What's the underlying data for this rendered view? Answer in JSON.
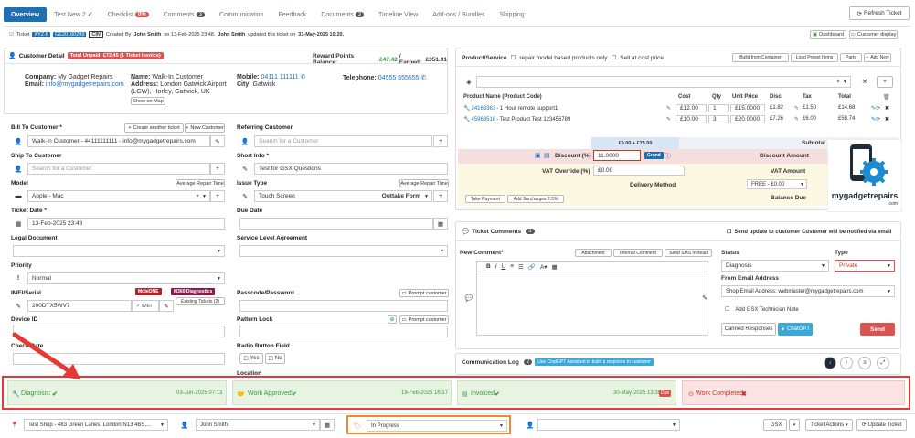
{
  "tabs": [
    {
      "label": "Overview"
    },
    {
      "label": "Test New 2",
      "mark": "✔"
    },
    {
      "label": "Checklist",
      "badge": "0%"
    },
    {
      "label": "Comments",
      "badge": "3"
    },
    {
      "label": "Communication"
    },
    {
      "label": "Feedback"
    },
    {
      "label": "Documents",
      "badge": "3"
    },
    {
      "label": "Timeline View"
    },
    {
      "label": "Add-ons / Bundles"
    },
    {
      "label": "Shipping"
    }
  ],
  "refresh_label": "Refresh Ticket",
  "infobar": {
    "ticket_prefix": "Ticket",
    "ticket_id": "XYZ-8",
    "ticket_ref": "GE20160299",
    "cin": "CIN",
    "created_text": "Created By",
    "created_by": "John Smith",
    "created_on": "on 13-Feb-2025 23:48.",
    "updated_by": "John Smith",
    "updated_text": "updated this ticket on",
    "updated_on": "31-May-2025 10:20.",
    "dashboard_label": "Dashboard",
    "customer_display_label": "Customer display"
  },
  "customer": {
    "title": "Customer Detail",
    "unpaid_badge": "Total Unpaid: £72.45 (1 Ticket Invoice)",
    "reward_label": "Reward Points Balance:",
    "reward_balance": "£47.42",
    "earned_label": "/ Earned:",
    "earned": "£351.91",
    "company_label": "Company:",
    "company": "My Gadget Repairs",
    "email_label": "Email:",
    "email": "info@mygadgetrepairs.com",
    "name_label": "Name:",
    "name": "Walk-In Customer",
    "address_label": "Address:",
    "address": "London Gatwick Airport (LGW), Horley, Gatwick, UK",
    "show_map": "Show on Map",
    "mobile_label": "Mobile:",
    "mobile": "04111 111111",
    "city_label": "City:",
    "city": "Gatwick",
    "telephone_label": "Telephone:",
    "telephone": "04555 555555"
  },
  "form": {
    "bill_label": "Bill To Customer *",
    "create_another": "Create another ticket",
    "new_customer": "New Customer",
    "bill_value": "Walk-In Customer - 44111111111 - info@mygadgetrepairs.com",
    "referring_label": "Referring Customer",
    "referring_placeholder": "Search for a Customer",
    "ship_label": "Ship To Customer",
    "ship_placeholder": "Search for a Customer",
    "short_info_label": "Short Info *",
    "short_info_value": "Test for GSX Questions",
    "model_label": "Model",
    "avg_repair_time": "Average Repair Time",
    "model_value": "Apple - Mac",
    "issue_label": "Issue Type",
    "issue_value": "Touch Screen",
    "issue_form": "Outtake Form",
    "ticket_date_label": "Ticket Date *",
    "ticket_date_value": "13-Feb-2025 23:48",
    "due_date_label": "Due Date",
    "legal_label": "Legal Document",
    "sla_label": "Service Level Agreement",
    "priority_label": "Priority",
    "priority_value": "Normal",
    "imei_label": "IMEI/Serial",
    "imei_value": "200DTX5WV7",
    "imei_tag": "IMEI",
    "mobione": "MobiONE",
    "m360": "M360 Diagnostics",
    "existing_tickets": "Existing Tickets (2)",
    "passcode_label": "Passcode/Password",
    "prompt_customer": "Prompt customer",
    "device_id_label": "Device ID",
    "pattern_label": "Pattern Lock",
    "check_date_label": "Check Date",
    "radio_label": "Radio Button Field",
    "yes": "Yes",
    "no": "No",
    "location_label": "Location"
  },
  "product": {
    "title": "Product/Service",
    "repair_model_only": "repair model based products only",
    "sell_at_cost": "Sell at cost price",
    "build_container": "Build from Container",
    "load_preset": "Load Preset Items",
    "parts": "Parts",
    "add_new": "Add New",
    "headers": [
      "Product Name (Product Code)",
      "Cost",
      "Qty",
      "Unit Price",
      "Disc",
      "Tax",
      "Total"
    ],
    "rows": [
      {
        "code": "24163363",
        "name": "- 1 Hour remote support1",
        "cost": "£12.00",
        "qty": "1",
        "unit": "£15.0000",
        "disc": "£1.82",
        "tax": "£1.50",
        "total": "£14.68"
      },
      {
        "code": "45963516",
        "name": "- Test Product Test 123456789",
        "cost": "£10.00",
        "qty": "3",
        "unit": "£20.0000",
        "disc": "£7.26",
        "tax": "£6.00",
        "total": "£58.74"
      }
    ],
    "sum_line": "£0.00 + £75.00",
    "subtotal_label": "Subtotal",
    "discount_label": "Discount (%)",
    "discount_value": "11.0000",
    "grand_label": "Grand",
    "discount_amount_label": "Discount Amount",
    "vat_override_label": "VAT Override (%)",
    "vat_override_value": "£0.00",
    "vat_amount_label": "VAT Amount",
    "delivery_label": "Delivery Method",
    "delivery_value": "FREE - £0.00",
    "balance_due_label": "Balance Due",
    "take_payment": "Take Payment",
    "add_surcharges": "Add Surcharges 2.5%"
  },
  "logo": {
    "text": "mygadgetrepairs",
    "sub": ".com"
  },
  "comments": {
    "title": "Ticket Comments",
    "count": "3",
    "send_update_label": "Send update to customer Customer will be notified via email",
    "new_comment_label": "New Comment*",
    "attachment": "Attachment",
    "internal_comment": "Internal Comment",
    "send_sms": "Send SMS Instead",
    "status_label": "Status",
    "status_value": "Diagnosis",
    "type_label": "Type",
    "type_value": "Private",
    "from_email_label": "From Email Address",
    "from_email_value": "Shop Email Address: webmaster@mygadgetrepairs.com",
    "gsx_note": "Add GSX Technician Note",
    "canned": "Canned Responses",
    "chatgpt": "ChatGPT",
    "send": "Send"
  },
  "comm_log": {
    "title": "Communication Log",
    "count": "2",
    "assist": "Use ChatGPT Assistant to build a response to customer"
  },
  "status_tiles": [
    {
      "label": "Diagnosis:",
      "mark": "✔",
      "date": "03-Jun-2025 07:13",
      "state": "done"
    },
    {
      "label": "Work Approved:",
      "mark": "✔",
      "date": "19-Feb-2025 16:17",
      "state": "done"
    },
    {
      "label": "Invoiced",
      "mark": "✔",
      "date": "30-May-2025 13:30",
      "due": "Due",
      "state": "done"
    },
    {
      "label": "Work Completed:",
      "mark": "✖",
      "date": "",
      "state": "pending"
    }
  ],
  "bottom": {
    "shop": "Test Shop - 483 Green Lanes, London N13 4BS,...",
    "assignee": "John Smith",
    "status": "In Progress",
    "gsx": "GSX",
    "ticket_actions": "Ticket Actions",
    "update_ticket": "Update Ticket"
  },
  "colors": {
    "accent": "#1f6fb3",
    "green_tile": "#e7f4e2",
    "red_tile": "#fbe3e3",
    "annotation": "#e53935",
    "highlight": "#f0882c"
  }
}
